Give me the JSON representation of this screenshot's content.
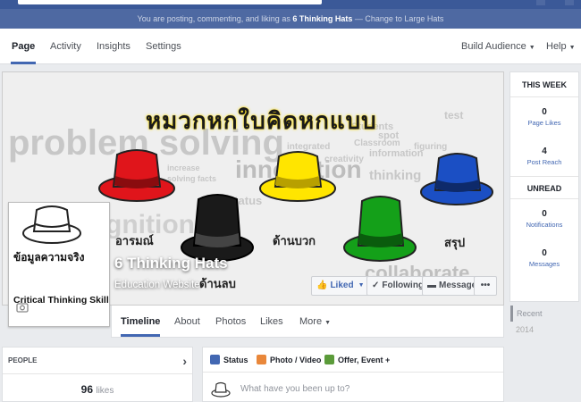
{
  "posting_bar": {
    "prefix": "You are posting, commenting, and liking as",
    "page": "6 Thinking Hats",
    "suffix": "— Change to Large Hats"
  },
  "page_nav": {
    "tabs": [
      "Page",
      "Activity",
      "Insights",
      "Settings"
    ],
    "build_audience": "Build Audience",
    "help": "Help"
  },
  "cover": {
    "title_thai": "หมวกหกใบคิดหกแบบ",
    "words": [
      "problem solving",
      "innovation",
      "collaborate",
      "thinking",
      "Students",
      "Classroom",
      "integrated",
      "creativity",
      "information",
      "status",
      "figuring",
      "increase",
      "solving facts",
      "spot",
      "test",
      "cognition"
    ],
    "hat_labels": {
      "red": "อารมณ์",
      "yellow": "ด้านบวก",
      "black": "ด้านลบ",
      "blue": "สรุป"
    },
    "hat_colors": {
      "white": "#ffffff",
      "red": "#e0151b",
      "black": "#1a1a1a",
      "yellow": "#ffe500",
      "green": "#14a019",
      "blue": "#1b4fc4"
    },
    "page_name": "6 Thinking Hats",
    "category": "Education Website",
    "buttons": {
      "liked": "Liked",
      "following": "Following",
      "message": "Message",
      "more": "•••"
    }
  },
  "profile": {
    "thai": "ข้อมูลความจริง",
    "skill": "Critical Thinking Skill"
  },
  "timeline_tabs": [
    "Timeline",
    "About",
    "Photos",
    "Likes",
    "More"
  ],
  "this_week": {
    "header": "THIS WEEK",
    "page_likes": {
      "num": "0",
      "label": "Page Likes"
    },
    "post_reach": {
      "num": "4",
      "label": "Post Reach"
    },
    "unread_header": "UNREAD",
    "notifications": {
      "num": "0",
      "label": "Notifications"
    },
    "messages": {
      "num": "0",
      "label": "Messages"
    }
  },
  "timeline_nav": {
    "recent": "Recent",
    "year": "2014"
  },
  "people": {
    "header": "PEOPLE",
    "likes_count": "96",
    "likes_label": "likes"
  },
  "composer": {
    "status": "Status",
    "photo": "Photo / Video",
    "offer": "Offer, Event +",
    "placeholder": "What have you been up to?",
    "colors": {
      "status": "#4267b2",
      "photo": "#e9873a",
      "offer": "#5b9b3a"
    }
  },
  "accent": "#3b5998"
}
